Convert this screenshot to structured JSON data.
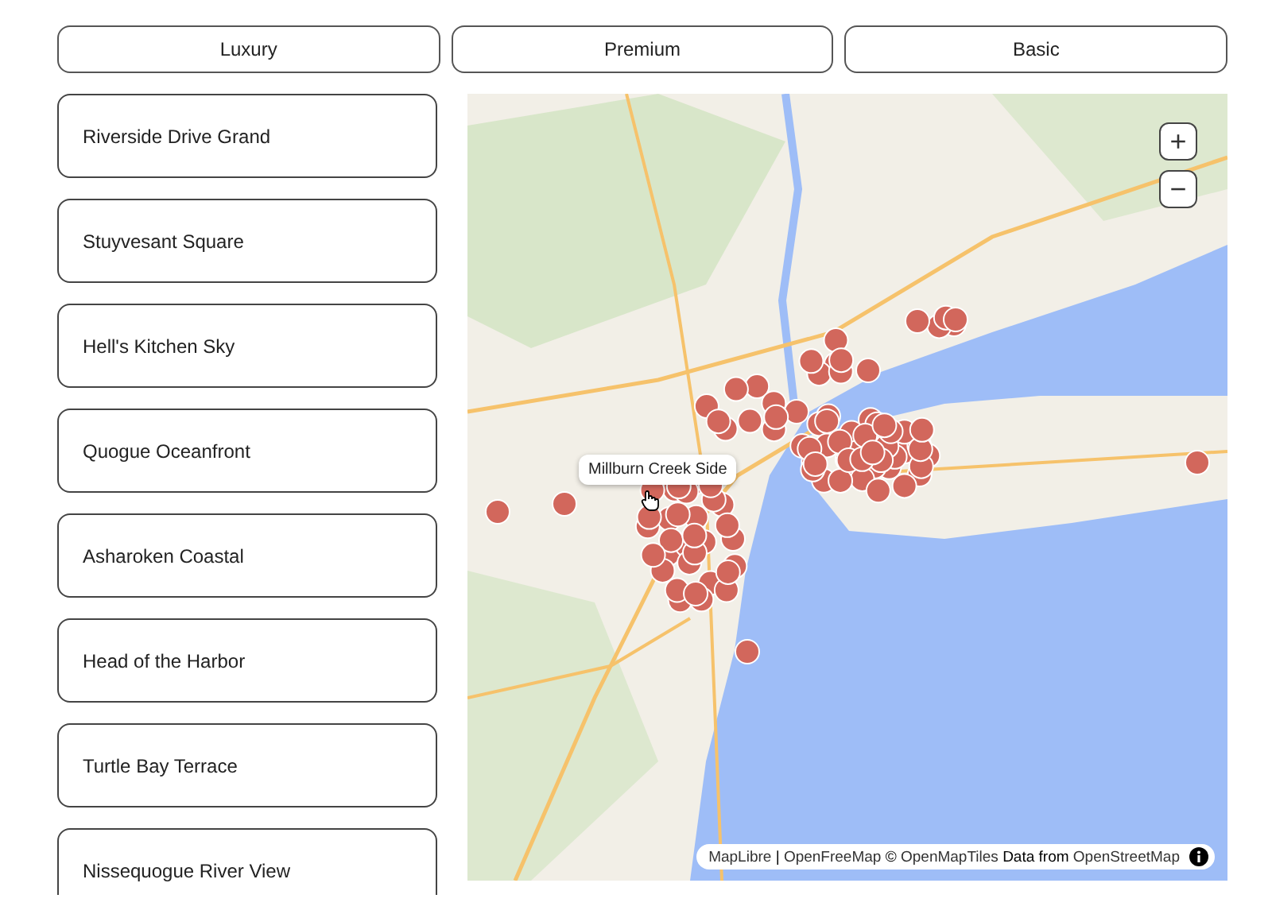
{
  "tabs": [
    {
      "label": "Luxury",
      "selected": false
    },
    {
      "label": "Premium",
      "selected": false
    },
    {
      "label": "Basic",
      "selected": false
    }
  ],
  "listings": [
    "Riverside Drive Grand",
    "Stuyvesant Square",
    "Hell's Kitchen Sky",
    "Quogue Oceanfront",
    "Asharoken Coastal",
    "Head of the Harbor",
    "Turtle Bay Terrace",
    "Nissequogue River View"
  ],
  "map": {
    "kind": "picture",
    "tooltip": "Millburn Creek Side",
    "zoom_in": "+",
    "zoom_out": "−",
    "attribution": [
      {
        "kind": "link",
        "text": "MapLibre"
      },
      {
        "kind": "text",
        "text": "|"
      },
      {
        "kind": "link",
        "text": "OpenFreeMap"
      },
      {
        "kind": "text",
        "text": "©"
      },
      {
        "kind": "link",
        "text": "OpenMapTiles"
      },
      {
        "kind": "text",
        "text": "Data from"
      },
      {
        "kind": "link",
        "text": "OpenStreetMap"
      }
    ]
  }
}
